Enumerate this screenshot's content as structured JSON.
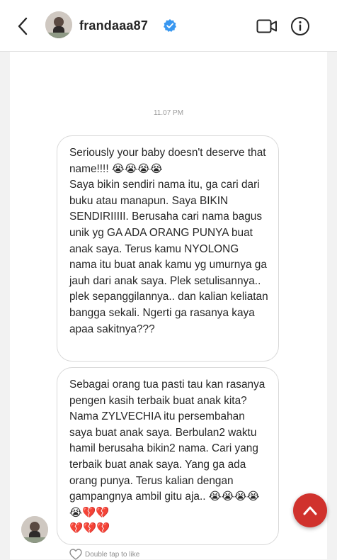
{
  "header": {
    "username": "frandaaa87",
    "back_icon": "chevron-left-icon",
    "verified_icon": "verified-badge-icon",
    "video_icon": "video-call-icon",
    "info_icon": "info-icon"
  },
  "conversation": {
    "timestamp": "11.07 PM",
    "messages": [
      {
        "text": "Seriously your baby doesn't deserve that name!!!! 😭😭😭😭\nSaya bikin sendiri nama itu, ga cari dari buku atau manapun. Saya BIKIN SENDIRIIIII. Berusaha cari nama bagus unik yg GA ADA ORANG PUNYA buat anak saya. Terus kamu NYOLONG nama itu buat anak kamu yg umurnya ga jauh dari anak saya. Plek setulisannya.. plek sepanggilannya.. dan kalian keliatan bangga sekali. Ngerti ga rasanya kaya apaa sakitnya???"
      },
      {
        "text": "Sebagai orang tua pasti tau kan rasanya pengen kasih terbaik buat anak kita? Nama ZYLVECHIA itu persembahan saya buat anak saya. Berbulan2 waktu hamil berusaha bikin2 nama. Cari yang terbaik buat anak saya. Yang ga ada orang punya. Terus kalian dengan gampangnya ambil gitu aja.. 😭😭😭😭😭💔💔\n💔💔💔"
      }
    ],
    "like_hint": "Double tap to like"
  },
  "colors": {
    "accent_red": "#d0322d",
    "verified_blue": "#3897f0",
    "text": "#262626",
    "bubble_border": "#d9d9d9"
  }
}
